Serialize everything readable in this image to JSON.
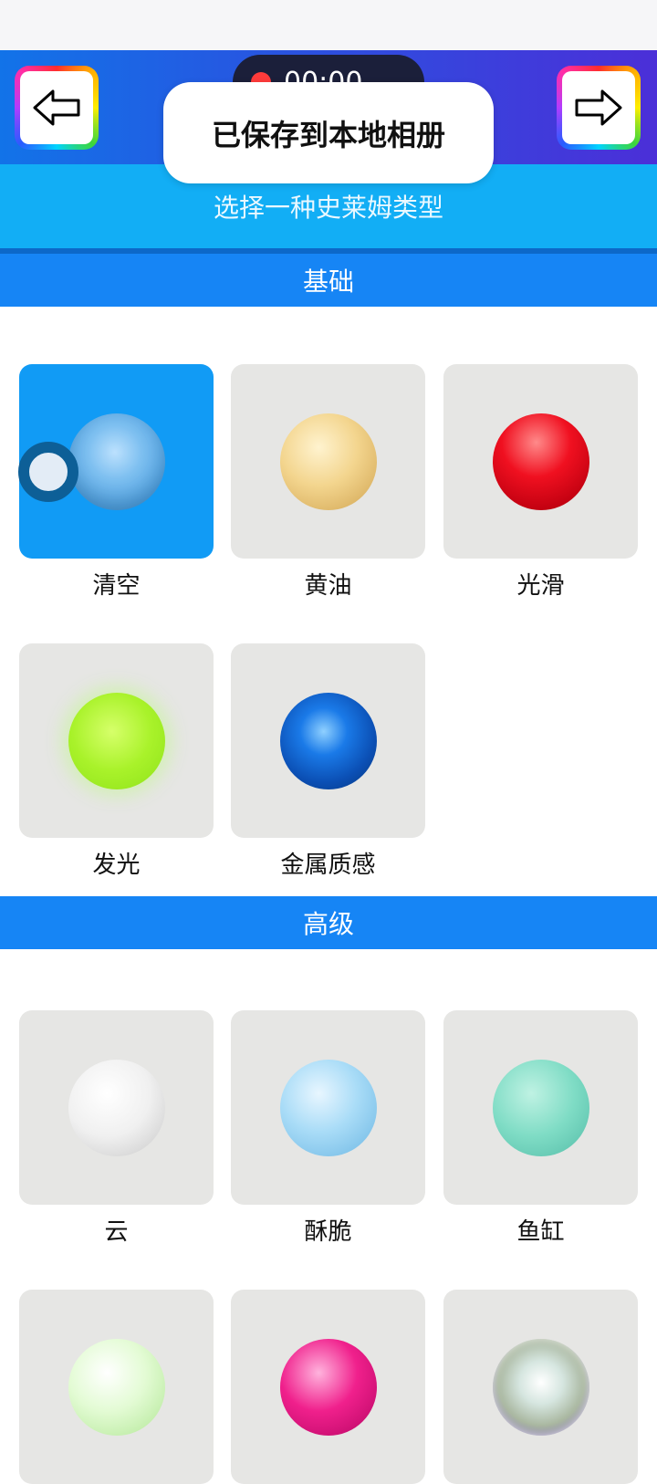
{
  "header": {
    "timer": "00:00",
    "subtitle": "选择一种史莱姆类型"
  },
  "toast": "已保存到本地相册",
  "sections": {
    "basic": {
      "title": "基础",
      "items": [
        "清空",
        "黄油",
        "光滑",
        "发光",
        "金属质感"
      ]
    },
    "advanced": {
      "title": "高级",
      "items": [
        "云",
        "酥脆",
        "鱼缸"
      ]
    }
  },
  "icons": {
    "back": "left-arrow-icon",
    "forward": "right-arrow-icon",
    "record": "record-dot-icon"
  }
}
